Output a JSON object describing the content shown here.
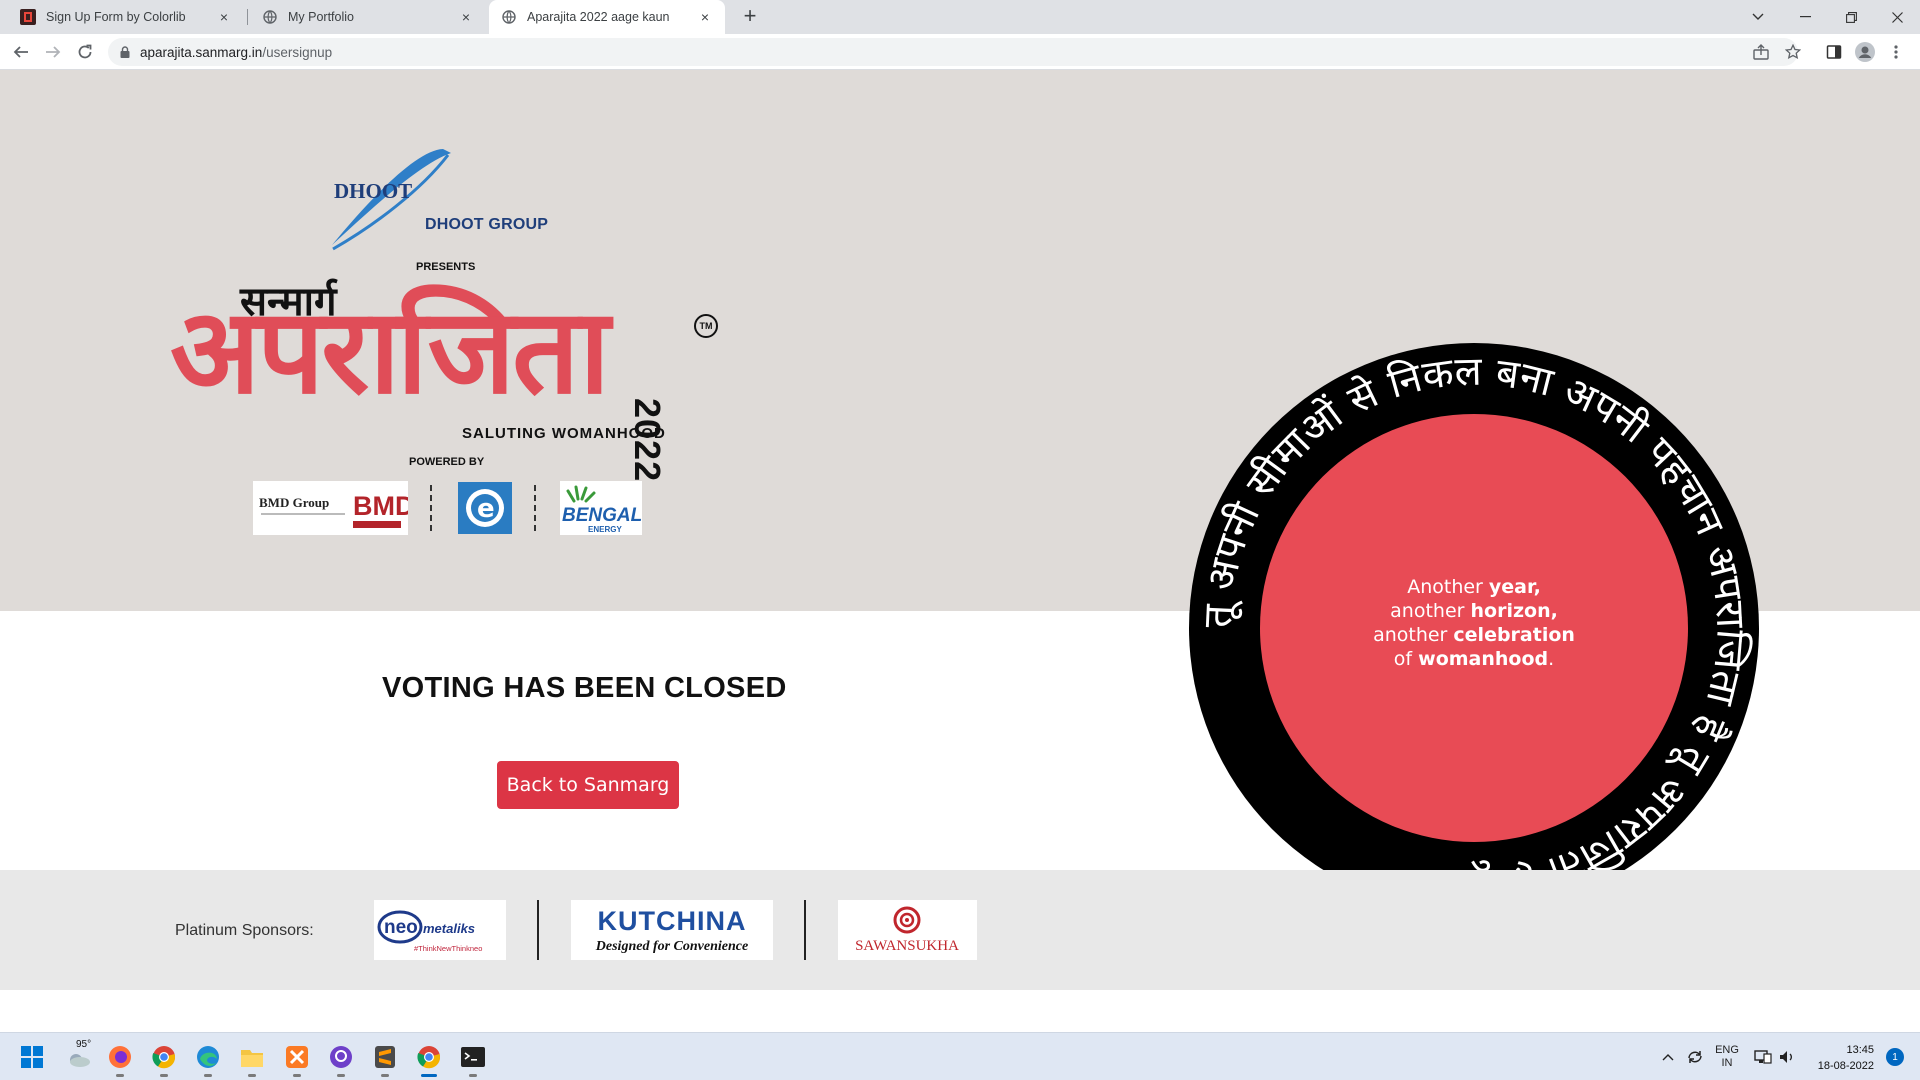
{
  "browser": {
    "tabs": [
      {
        "title": "Sign Up Form by Colorlib",
        "close": "×"
      },
      {
        "title": "My Portfolio",
        "close": "×"
      },
      {
        "title": "Aparajita 2022 aage kaun",
        "close": "×"
      }
    ],
    "new_tab": "+",
    "url_host": "aparajita.sanmarg.in",
    "url_path": "/usersignup"
  },
  "hero": {
    "dhoot_brand": "DHOOT",
    "dhoot_group": "DHOOT GROUP",
    "presents": "PRESENTS",
    "sanmarg": "सन्मार्ग",
    "aparajita": "अपराजिता",
    "tm": "TM",
    "year": "2022",
    "tagline": "SALUTING WOMANHOOD",
    "powered_by": "POWERED BY",
    "powered_sponsors": [
      {
        "name": "BMD Group",
        "sub": "BMD"
      },
      {
        "name": "e"
      },
      {
        "name": "BENGAL",
        "sub": "ENERGY"
      }
    ]
  },
  "main": {
    "status_heading": "VOTING HAS BEEN CLOSED",
    "back_button": "Back to Sanmarg"
  },
  "badge": {
    "ring_text": "तू अपनी सीमाओं से निकल  बना अपनी पहचान  अपराजिता है तू  अपराजिता है तू ",
    "line1_a": "Another ",
    "line1_b": "year,",
    "line2_a": "another ",
    "line2_b": "horizon,",
    "line3_a": "another ",
    "line3_b": "celebration",
    "line4_a": "of ",
    "line4_b": "womanhood",
    "line4_c": ".",
    "ring_color": "#000000",
    "center_color": "#e84b55"
  },
  "footer": {
    "platinum_label": "Platinum Sponsors:",
    "sponsors": [
      {
        "name": "neo",
        "name2": "metaliks",
        "tag": "#ThinkNewThinkneo"
      },
      {
        "name": "KUTCHINA",
        "tag": "Designed for Convenience"
      },
      {
        "name": "SAWANSUKHA"
      }
    ]
  },
  "taskbar": {
    "weather": "95°",
    "lang": "ENG",
    "region": "IN",
    "time": "13:45",
    "date": "18-08-2022",
    "notifications": "1"
  }
}
